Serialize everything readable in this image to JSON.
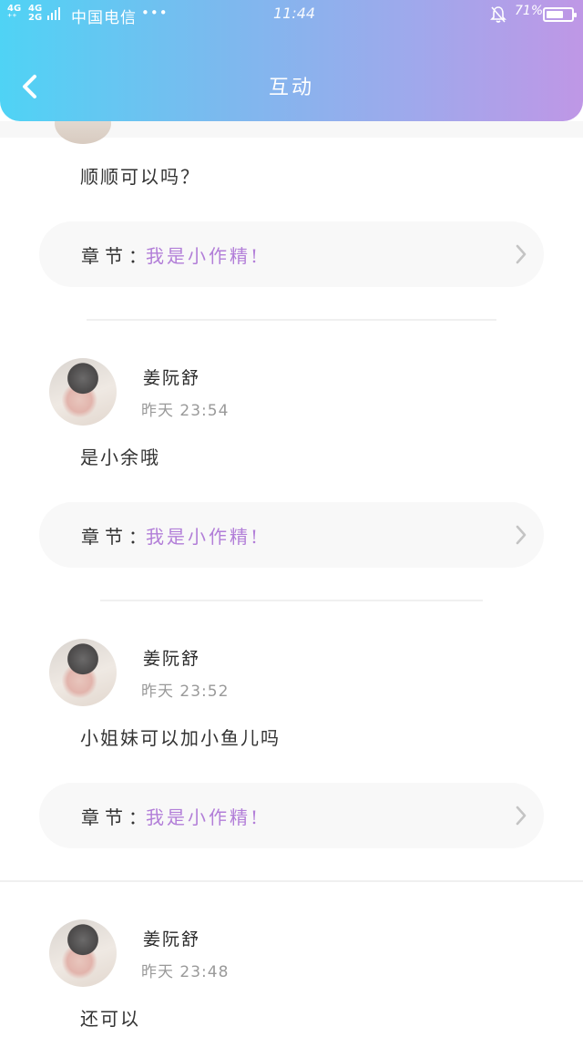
{
  "status_bar": {
    "network_1": [
      "4G",
      "⁺⁺"
    ],
    "network_2": [
      "4G",
      "2G"
    ],
    "carrier": "中国电信",
    "more": "•••",
    "time": "11:44",
    "battery_percent": "71%",
    "battery_level": 0.71
  },
  "header": {
    "title": "互动"
  },
  "comments": [
    {
      "text": "顺顺可以吗？",
      "chapter_label": "章节：",
      "chapter_title": "我是小作精!"
    },
    {
      "name": "姜阮舒",
      "time": "昨天 23:54",
      "text": "是小余哦",
      "chapter_label": "章节：",
      "chapter_title": "我是小作精!"
    },
    {
      "name": "姜阮舒",
      "time": "昨天 23:52",
      "text": "小姐妹可以加小鱼儿吗",
      "chapter_label": "章节：",
      "chapter_title": "我是小作精!"
    },
    {
      "name": "姜阮舒",
      "time": "昨天 23:48",
      "text": "还可以"
    }
  ],
  "icons": {
    "back": "back-arrow-icon",
    "chevron": "chevron-right-icon",
    "bell": "bell-off-icon"
  }
}
